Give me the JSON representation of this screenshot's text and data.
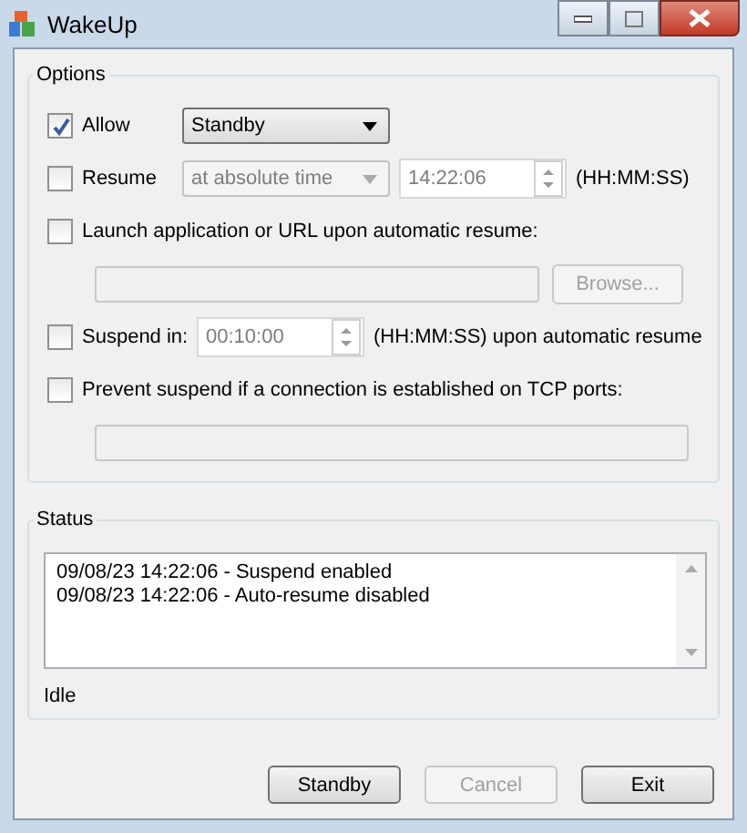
{
  "window": {
    "title": "WakeUp"
  },
  "options": {
    "title": "Options",
    "allow": {
      "label": "Allow",
      "checked": true,
      "value": "Standby"
    },
    "resume": {
      "label": "Resume",
      "checked": false,
      "mode": "at absolute time",
      "time": "14:22:06",
      "format": "(HH:MM:SS)",
      "disabled": true
    },
    "launch": {
      "label": "Launch application or URL upon automatic resume:",
      "checked": false,
      "browse": "Browse...",
      "disabled": true
    },
    "suspend": {
      "label": "Suspend in:",
      "checked": false,
      "time": "00:10:00",
      "note": "(HH:MM:SS) upon automatic resume",
      "disabled": true
    },
    "prevent": {
      "label": "Prevent suspend if a connection is established on TCP ports:",
      "checked": false,
      "disabled": true
    }
  },
  "status": {
    "title": "Status",
    "log": [
      "09/08/23 14:22:06 - Suspend enabled",
      "09/08/23 14:22:06 - Auto-resume disabled"
    ],
    "state": "Idle"
  },
  "buttons": [
    {
      "label": "Standby",
      "disabled": false
    },
    {
      "label": "Cancel",
      "disabled": true
    },
    {
      "label": "Exit",
      "disabled": false
    }
  ]
}
